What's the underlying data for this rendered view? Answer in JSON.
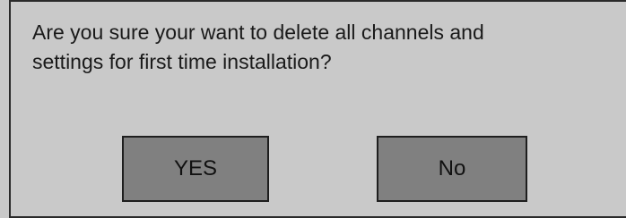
{
  "dialog": {
    "message_line1": "Are you sure your want to delete all channels and",
    "message_line2": "settings for first time installation?",
    "yes_label": "YES",
    "no_label": "No"
  },
  "colors": {
    "background": "#c9c9c9",
    "button_fill": "#808080",
    "border": "#1e1e1e",
    "text": "#1a1a1a"
  }
}
